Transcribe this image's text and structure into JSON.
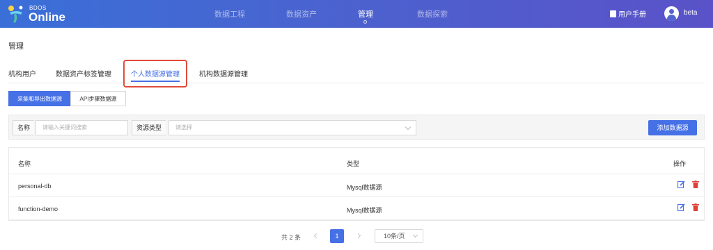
{
  "brand": {
    "small": "BDOS",
    "name": "Online"
  },
  "nav": {
    "items": [
      {
        "label": "数据工程"
      },
      {
        "label": "数据资产"
      },
      {
        "label": "管理"
      },
      {
        "label": "数据探索"
      }
    ],
    "active_index": 2,
    "manual": "用户手册",
    "user": "beta"
  },
  "page": {
    "title": "管理"
  },
  "tabs": {
    "items": [
      {
        "label": "机构用户"
      },
      {
        "label": "数据资产标签管理"
      },
      {
        "label": "个人数据源管理"
      },
      {
        "label": "机构数据源管理"
      }
    ],
    "active_index": 2
  },
  "subtabs": [
    {
      "label": "采集和导出数据源"
    },
    {
      "label": "API步骤数据源"
    }
  ],
  "filter": {
    "name_label": "名称",
    "name_placeholder": "请输入关键词搜索",
    "type_label": "资源类型",
    "type_placeholder": "请选择",
    "add_button": "添加数据源"
  },
  "table": {
    "headers": {
      "name": "名称",
      "type": "类型",
      "actions": "操作"
    },
    "rows": [
      {
        "name": "personal-db",
        "type": "Mysql数据源"
      },
      {
        "name": "function-demo",
        "type": "Mysql数据源"
      }
    ]
  },
  "pagination": {
    "total": "共 2 条",
    "current": "1",
    "page_size": "10条/页"
  },
  "colors": {
    "primary": "#4670e6",
    "highlight": "#e04a3a",
    "danger": "#e0403a"
  },
  "icons": [
    "book-icon",
    "user-icon",
    "edit-icon",
    "delete-icon",
    "chevron-down-icon",
    "chevron-left-icon",
    "chevron-right-icon"
  ]
}
